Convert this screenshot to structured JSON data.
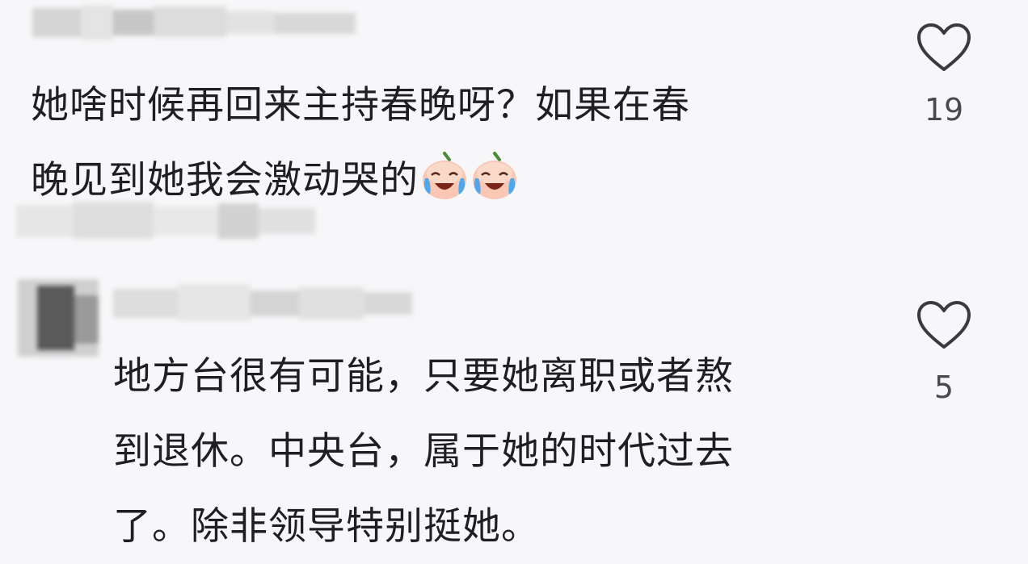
{
  "comments": [
    {
      "text_lines": [
        "她啥时候再回来主持春晚呀？如果在春",
        "晚见到她我会激动哭的"
      ],
      "emojis": [
        "crying-laughing-peach-emoji",
        "crying-laughing-peach-emoji"
      ],
      "like_count": "19"
    },
    {
      "text_lines": [
        "地方台很有可能，只要她离职或者熬",
        "到退休。中央台，属于她的时代过去",
        "了。除非领导特别挺她。"
      ],
      "like_count": "5"
    }
  ],
  "icons": {
    "like": "heart-outline-icon"
  },
  "colors": {
    "background": "#f7f7f9",
    "text": "#1f1f21",
    "count": "#4a4a4e"
  }
}
